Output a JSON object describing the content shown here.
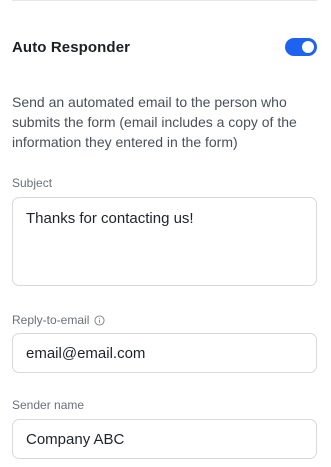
{
  "auto_responder": {
    "title": "Auto Responder",
    "enabled": true,
    "description": "Send an automated email to the person who submits the form (email includes a copy of the information they entered in the form)"
  },
  "fields": {
    "subject": {
      "label": "Subject",
      "value": "Thanks for contacting us!"
    },
    "reply_to": {
      "label": "Reply-to-email",
      "value": "email@email.com",
      "icon": "info-icon"
    },
    "sender_name": {
      "label": "Sender name",
      "value": "Company ABC"
    }
  },
  "colors": {
    "toggle_on": "#1e63f0",
    "border": "#d5d8dd"
  }
}
